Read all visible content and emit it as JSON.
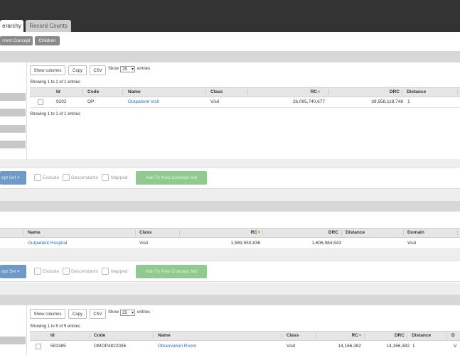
{
  "tabs": {
    "hierarchy": "erarchy",
    "record_counts": "Record Counts"
  },
  "subnav": {
    "current_concept": "rrent Concept",
    "children": "Children"
  },
  "table_controls": {
    "show_columns": "Show columns",
    "copy": "Copy",
    "csv": "CSV",
    "show_label": "Show",
    "entries_value": "25",
    "entries_label": "entries"
  },
  "table1": {
    "info_top": "Showing 1 to 1 of 1 entries",
    "info_bottom": "Showing 1 to 1 of 1 entries",
    "headers": {
      "id": "Id",
      "code": "Code",
      "name": "Name",
      "class": "Class",
      "rc": "RC",
      "drc": "DRC",
      "distance": "Distance"
    },
    "rows": [
      {
        "id": "9202",
        "code": "OP",
        "name": "Outpatient Visit",
        "class": "Visit",
        "rc": "26,095,740,677",
        "drc": "39,558,118,748",
        "distance": "1"
      }
    ]
  },
  "actions": {
    "concept_set_button": "ept Set",
    "exclude": "Exclude",
    "descendants": "Descendants",
    "mapped": "Mapped",
    "add_new": "Add To New Concept Set"
  },
  "table2": {
    "headers": {
      "name": "Name",
      "class": "Class",
      "rc": "RC",
      "drc": "DRC",
      "distance": "Distance",
      "domain": "Domain"
    },
    "rows": [
      {
        "name": "Outpatient Hospital",
        "class": "Visit",
        "rc": "1,589,550,836",
        "drc": "1,606,984,543",
        "distance": "",
        "domain": "Visit"
      }
    ]
  },
  "table3": {
    "info_top": "Showing 1 to 5 of 5 entries",
    "headers": {
      "id": "Id",
      "code": "Code",
      "name": "Name",
      "class": "Class",
      "rc": "RC",
      "drc": "DRC",
      "distance": "Distance",
      "extra": "D"
    },
    "rows": [
      {
        "id": "581385",
        "code": "OMOP4822036",
        "name": "Observation Room",
        "class": "Visit",
        "rc": "14,166,382",
        "drc": "14,166,382",
        "distance": "1",
        "extra": "V"
      }
    ]
  },
  "sort_glyph": "▾",
  "colors": {
    "accent_blue": "#2a6ebb",
    "sort_orange": "#e07b20",
    "header_dark": "#333333"
  }
}
